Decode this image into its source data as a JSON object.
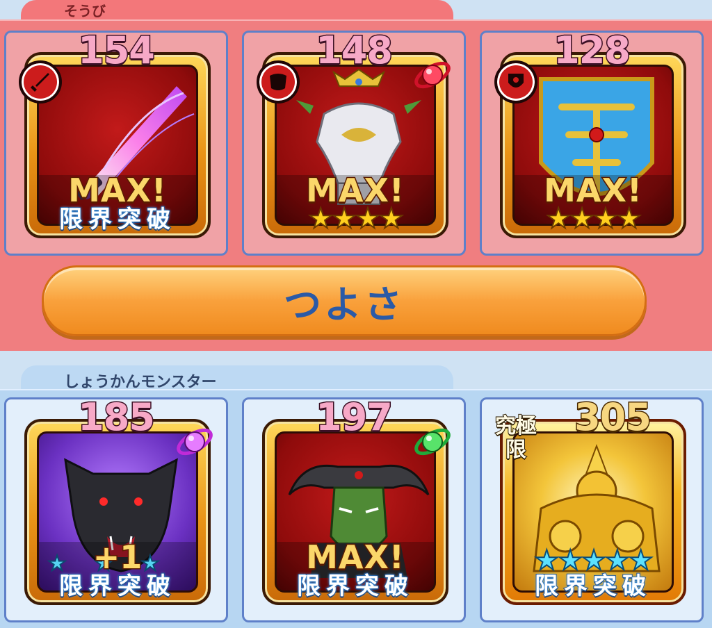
{
  "equipment": {
    "tab_label": "そうび",
    "slots": [
      {
        "power": "154",
        "type_icon": "sword-icon",
        "art_icon": "sword-art-icon",
        "status": "MAX!",
        "stars_visible": 0,
        "footer": "限界突破"
      },
      {
        "power": "148",
        "type_icon": "armor-icon",
        "art_icon": "armor-art-icon",
        "orb": "red-orb-icon",
        "status": "MAX!",
        "stars_visible": 4,
        "footer": ""
      },
      {
        "power": "128",
        "type_icon": "shield-icon",
        "art_icon": "shield-art-icon",
        "status": "MAX!",
        "stars_visible": 4,
        "footer": ""
      }
    ],
    "strength_button_label": "つよさ"
  },
  "summon_monster": {
    "tab_label": "しょうかんモンスター",
    "slots": [
      {
        "power": "185",
        "art_icon": "wolf-monster-icon",
        "orb": "purple-orb-icon",
        "status": "+1",
        "footer": "限界突破"
      },
      {
        "power": "197",
        "art_icon": "horned-demon-icon",
        "orb": "green-orb-icon",
        "status": "MAX!",
        "footer": "限界突破"
      },
      {
        "power": "305",
        "art_icon": "golden-golem-icon",
        "badge": "究極限",
        "status": "",
        "stars_visible": 5,
        "footer": "限界突破"
      }
    ]
  },
  "colors": {
    "equip_panel": "#f07e80",
    "summon_panel": "#b7d6f2",
    "button": "#f9a13c",
    "button_text": "#2b5aa6"
  }
}
